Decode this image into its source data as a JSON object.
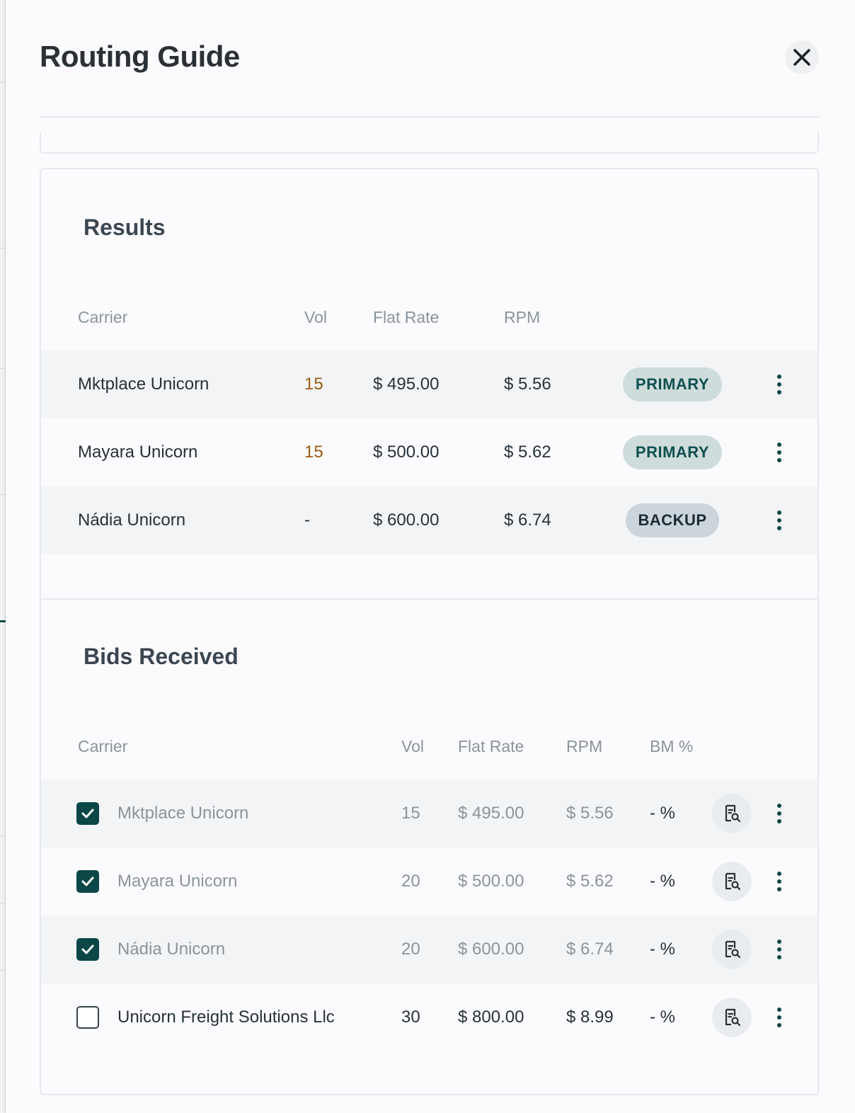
{
  "header": {
    "title": "Routing Guide",
    "close_icon": "close-icon"
  },
  "results": {
    "title": "Results",
    "columns": [
      "Carrier",
      "Vol",
      "Flat Rate",
      "RPM"
    ],
    "rows": [
      {
        "carrier": "Mktplace Unicorn",
        "vol": "15",
        "flat_rate": "$ 495.00",
        "rpm": "$ 5.56",
        "status": "PRIMARY"
      },
      {
        "carrier": "Mayara Unicorn",
        "vol": "15",
        "flat_rate": "$ 500.00",
        "rpm": "$ 5.62",
        "status": "PRIMARY"
      },
      {
        "carrier": "Nádia Unicorn",
        "vol": "-",
        "flat_rate": "$ 600.00",
        "rpm": "$ 6.74",
        "status": "BACKUP"
      }
    ]
  },
  "bids": {
    "title": "Bids Received",
    "columns": [
      "Carrier",
      "Vol",
      "Flat Rate",
      "RPM",
      "BM %"
    ],
    "rows": [
      {
        "checked": true,
        "carrier": "Mktplace Unicorn",
        "vol": "15",
        "flat_rate": "$ 495.00",
        "rpm": "$ 5.56",
        "bm": "- %"
      },
      {
        "checked": true,
        "carrier": "Mayara Unicorn",
        "vol": "20",
        "flat_rate": "$ 500.00",
        "rpm": "$ 5.62",
        "bm": "- %"
      },
      {
        "checked": true,
        "carrier": "Nádia Unicorn",
        "vol": "20",
        "flat_rate": "$ 600.00",
        "rpm": "$ 6.74",
        "bm": "- %"
      },
      {
        "checked": false,
        "carrier": "Unicorn Freight Solutions Llc",
        "vol": "30",
        "flat_rate": "$ 800.00",
        "rpm": "$ 8.99",
        "bm": "- %"
      }
    ]
  },
  "colors": {
    "accent": "#0b4747",
    "badge_primary_bg": "#cfdcdc",
    "badge_backup_bg": "#ccd5dc",
    "vol_highlight": "#9a5a10"
  }
}
